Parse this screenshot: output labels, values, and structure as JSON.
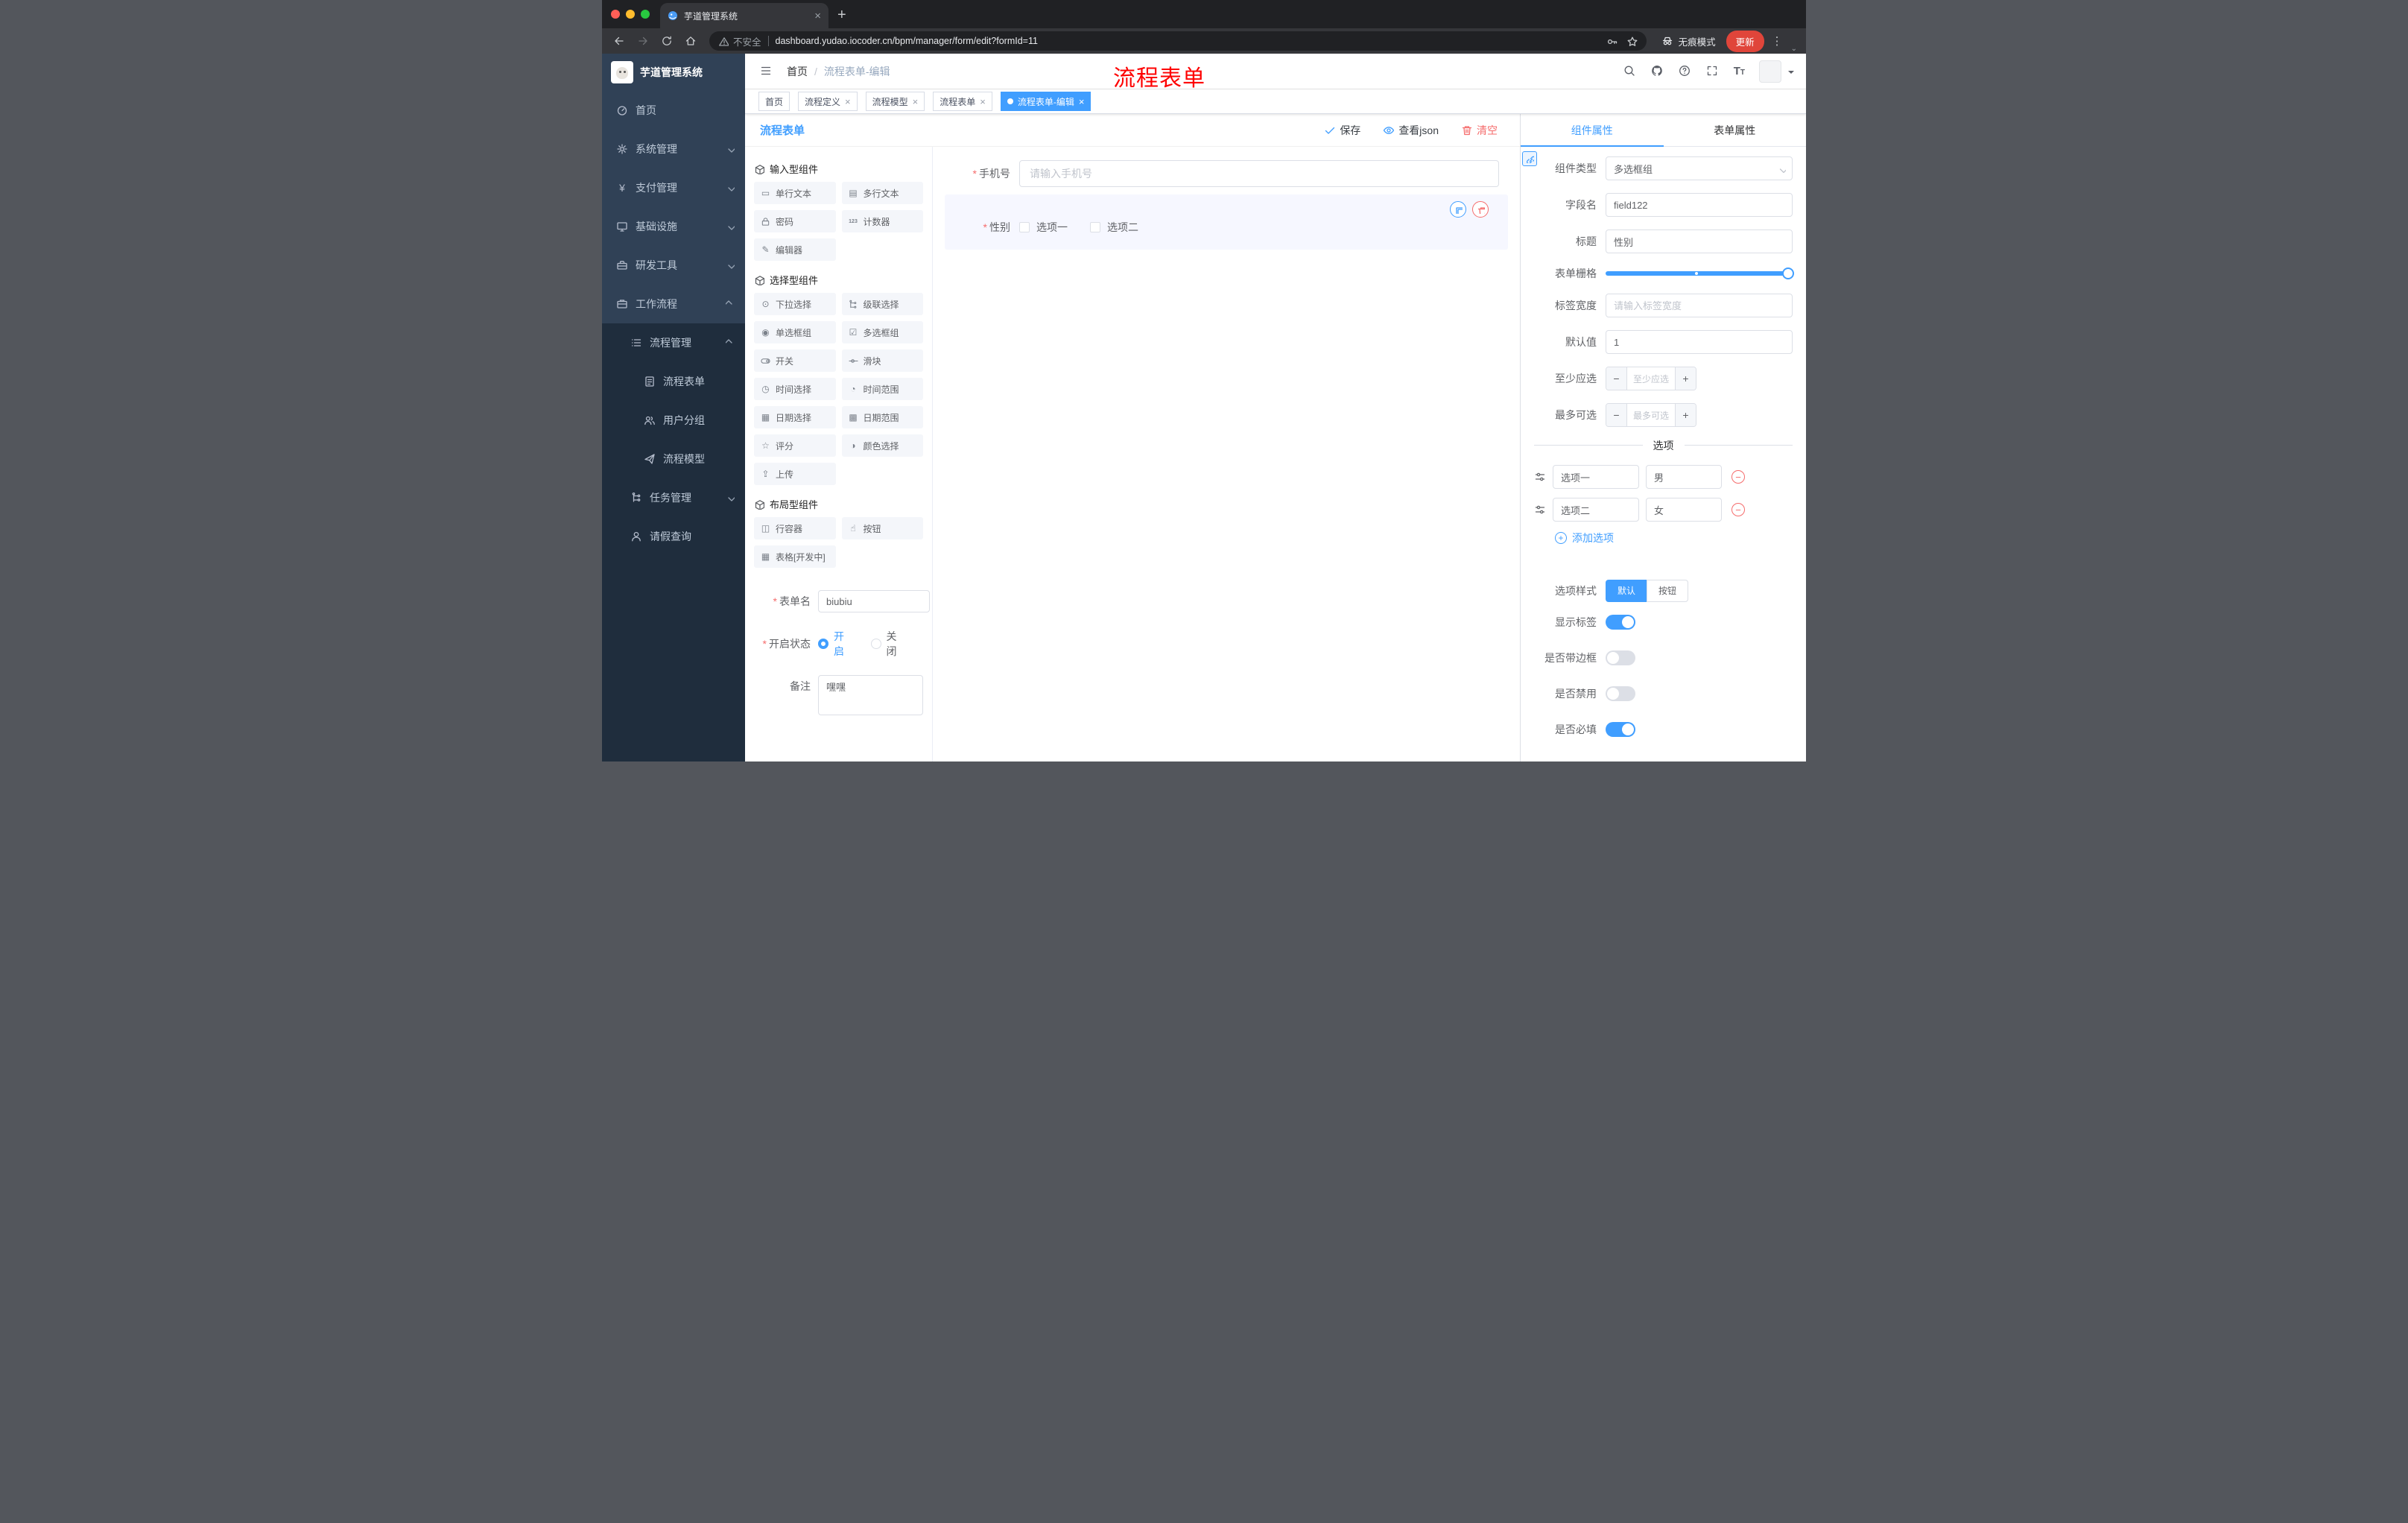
{
  "colors": {
    "accent": "#409EFF",
    "danger": "#F56C6C",
    "update_badge": "#E0453A",
    "sidebar_bg": "#304156",
    "sidebar_submenu_bg": "#1F2D3D",
    "watermark_red": "#FE0000"
  },
  "browser": {
    "tab_title": "芋道管理系统",
    "address": {
      "security": "不安全",
      "url": "dashboard.yudao.iocoder.cn/bpm/manager/form/edit?formId=11"
    },
    "incognito": "无痕模式",
    "update": "更新"
  },
  "sidebar": {
    "logo_title": "芋道管理系统",
    "menu": [
      {
        "label": "首页"
      },
      {
        "label": "系统管理"
      },
      {
        "label": "支付管理"
      },
      {
        "label": "基础设施"
      },
      {
        "label": "研发工具"
      },
      {
        "label": "工作流程"
      },
      {
        "label": "流程管理"
      },
      {
        "label": "流程表单"
      },
      {
        "label": "用户分组"
      },
      {
        "label": "流程模型"
      },
      {
        "label": "任务管理"
      },
      {
        "label": "请假查询"
      }
    ]
  },
  "header": {
    "breadcrumb_home": "首页",
    "breadcrumb_current": "流程表单-编辑",
    "watermark": "流程表单"
  },
  "tags": [
    "首页",
    "流程定义",
    "流程模型",
    "流程表单",
    "流程表单-编辑"
  ],
  "editor": {
    "title": "流程表单",
    "save": "保存",
    "view_json": "查看json",
    "clear": "清空"
  },
  "palette": {
    "groups": [
      {
        "title": "输入型组件",
        "items": [
          {
            "label": "单行文本"
          },
          {
            "label": "多行文本"
          },
          {
            "label": "密码"
          },
          {
            "label": "计数器"
          },
          {
            "label": "编辑器"
          }
        ]
      },
      {
        "title": "选择型组件",
        "items": [
          {
            "label": "下拉选择"
          },
          {
            "label": "级联选择"
          },
          {
            "label": "单选框组"
          },
          {
            "label": "多选框组"
          },
          {
            "label": "开关"
          },
          {
            "label": "滑块"
          },
          {
            "label": "时间选择"
          },
          {
            "label": "时间范围"
          },
          {
            "label": "日期选择"
          },
          {
            "label": "日期范围"
          },
          {
            "label": "评分"
          },
          {
            "label": "颜色选择"
          },
          {
            "label": "上传"
          }
        ]
      },
      {
        "title": "布局型组件",
        "items": [
          {
            "label": "行容器"
          },
          {
            "label": "按钮"
          },
          {
            "label": "表格[开发中]"
          }
        ]
      }
    ]
  },
  "form_meta": {
    "name_label": "表单名",
    "name_value": "biubiu",
    "status_label": "开启状态",
    "status_on": "开启",
    "status_off": "关闭",
    "remark_label": "备注",
    "remark_value": "嘿嘿"
  },
  "canvas": {
    "phone": {
      "label": "手机号",
      "placeholder": "请输入手机号"
    },
    "gender": {
      "label": "性别",
      "option1": "选项一",
      "option2": "选项二"
    }
  },
  "props": {
    "tab_component": "组件属性",
    "tab_form": "表单属性",
    "type_label": "组件类型",
    "type_value": "多选框组",
    "field_label": "字段名",
    "field_value": "field122",
    "title_label": "标题",
    "title_value": "性别",
    "grid_label": "表单栅格",
    "label_width_label": "标签宽度",
    "label_width_placeholder": "请输入标签宽度",
    "default_label": "默认值",
    "default_value": "1",
    "min_label": "至少应选",
    "min_placeholder": "至少应选",
    "max_label": "最多可选",
    "max_placeholder": "最多可选",
    "options_divider": "选项",
    "options": [
      {
        "label": "选项一",
        "value": "男"
      },
      {
        "label": "选项二",
        "value": "女"
      }
    ],
    "add_option": "添加选项",
    "style_label": "选项样式",
    "style_default": "默认",
    "style_button": "按钮",
    "show_label": "显示标签",
    "border_label": "是否带边框",
    "disabled_label": "是否禁用",
    "required_label": "是否必填"
  }
}
